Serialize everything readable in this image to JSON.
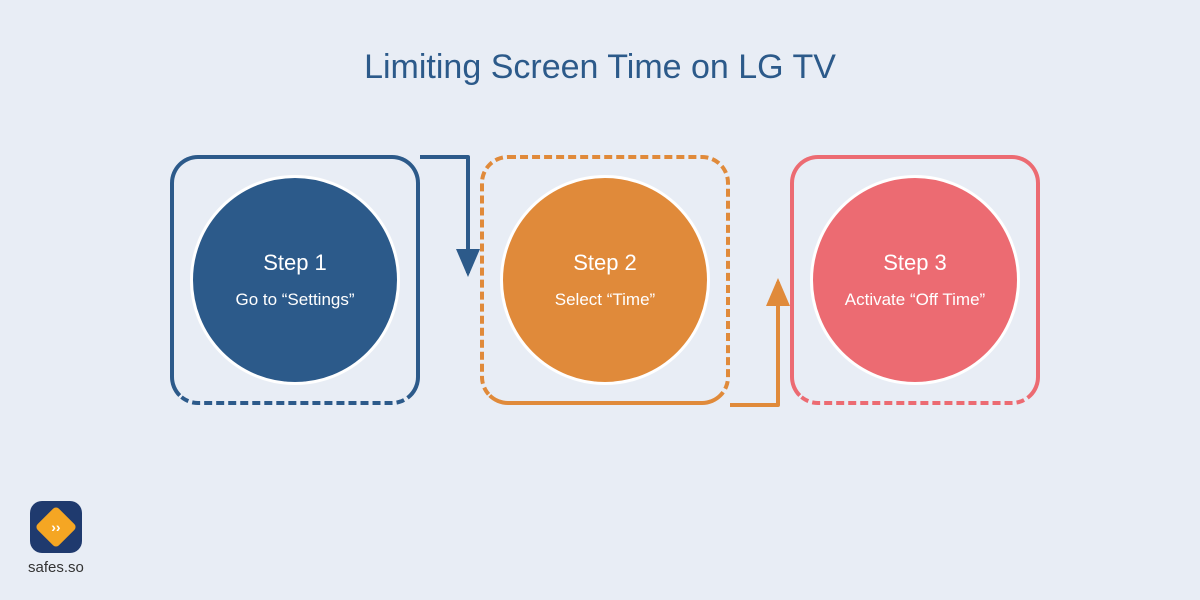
{
  "title": "Limiting Screen Time on LG TV",
  "steps": [
    {
      "label": "Step 1",
      "desc": "Go to “Settings”",
      "color": "#2c5a8a"
    },
    {
      "label": "Step 2",
      "desc": "Select “Time”",
      "color": "#e08a3a"
    },
    {
      "label": "Step 3",
      "desc": "Activate “Off Time”",
      "color": "#ec6b72"
    }
  ],
  "branding": {
    "site": "safes.so"
  }
}
